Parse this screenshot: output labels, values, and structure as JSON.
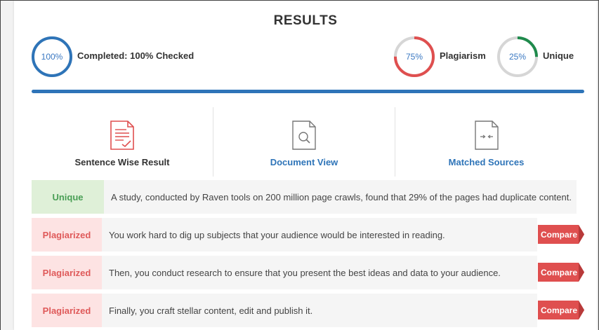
{
  "title": "RESULTS",
  "completed": {
    "percent_text": "100%",
    "progress": 1.0,
    "label": "Completed: 100% Checked",
    "color": "#2e74b8"
  },
  "plagiarism": {
    "percent_text": "75%",
    "progress": 0.75,
    "label": "Plagiarism",
    "color": "#df4f4f"
  },
  "unique": {
    "percent_text": "25%",
    "progress": 0.25,
    "label": "Unique",
    "color": "#1f8a4c"
  },
  "tabs": [
    {
      "label": "Sentence Wise Result",
      "icon": "document-check-icon",
      "active": true
    },
    {
      "label": "Document View",
      "icon": "document-search-icon",
      "active": false
    },
    {
      "label": "Matched Sources",
      "icon": "document-compare-icon",
      "active": false
    }
  ],
  "results": [
    {
      "status": "Unique",
      "text": "A study, conducted by Raven tools on 200 million page crawls, found that 29% of the pages had duplicate content."
    },
    {
      "status": "Plagiarized",
      "text": "You work hard to dig up subjects that your audience would be interested in reading.",
      "action": "Compare"
    },
    {
      "status": "Plagiarized",
      "text": "Then, you conduct research to ensure that you present the best ideas and data to your audience.",
      "action": "Compare"
    },
    {
      "status": "Plagiarized",
      "text": "Finally, you craft stellar content, edit and publish it.",
      "action": "Compare"
    }
  ]
}
